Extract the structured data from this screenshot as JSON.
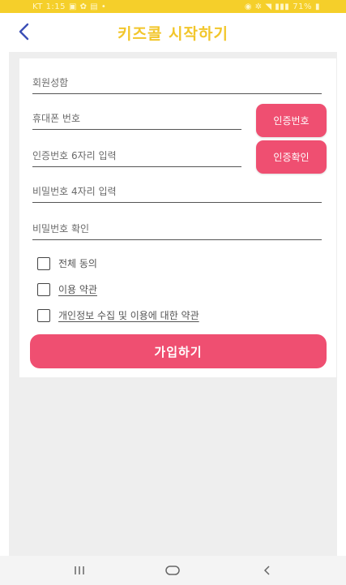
{
  "status_bar": {
    "carrier_time": "KT 1:15",
    "battery": "71%"
  },
  "header": {
    "title": "키즈콜 시작하기",
    "back_icon": "chevron-left-icon"
  },
  "form": {
    "name_placeholder": "회원성함",
    "phone_placeholder": "휴대폰 번호",
    "request_code_label": "인증번호",
    "code_placeholder": "인증번호 6자리 입력",
    "verify_code_label": "인증확인",
    "password_placeholder": "비밀번호 4자리 입력",
    "password_confirm_placeholder": "비밀번호 확인"
  },
  "agreements": {
    "all": "전체 동의",
    "terms_of_use": "이용 약관",
    "privacy": "개인정보 수집 및 이용에 대한 약관"
  },
  "submit_label": "가입하기",
  "colors": {
    "status_bar": "#f5cf2a",
    "title": "#f2c62b",
    "accent": "#ef4f71",
    "back_arrow": "#3b4fb5"
  },
  "nav": {
    "recent_icon": "recent-apps-icon",
    "home_icon": "home-icon",
    "back_icon": "back-icon"
  }
}
